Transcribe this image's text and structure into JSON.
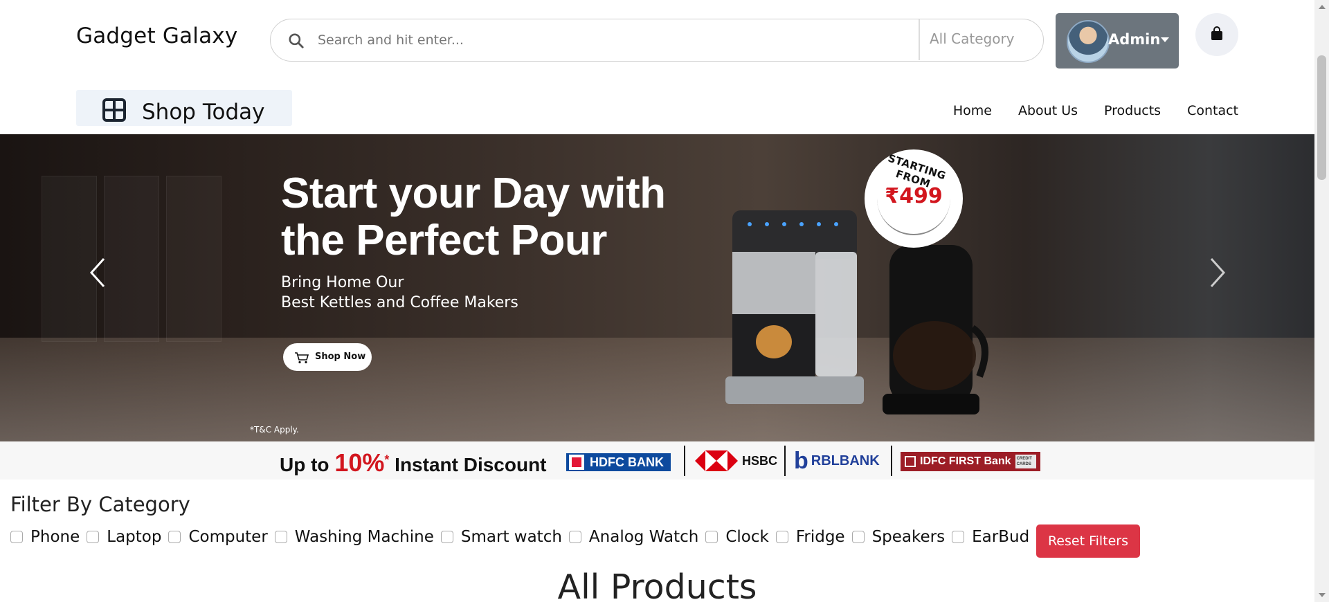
{
  "header": {
    "brand": "Gadget Galaxy",
    "search_placeholder": "Search and hit enter...",
    "category_select": "All Category",
    "user_label": "Admin",
    "cart_icon": "shopping-bag-icon"
  },
  "subheader": {
    "shop_today": "Shop Today",
    "nav": [
      "Home",
      "About Us",
      "Products",
      "Contact"
    ]
  },
  "banner": {
    "headline_line1": "Start your Day with",
    "headline_line2": "the Perfect Pour",
    "sub_line1": "Bring Home Our",
    "sub_line2": "Best Kettles and Coffee Makers",
    "cta": "Shop Now",
    "badge_top": "STARTING FROM",
    "badge_price": "₹499",
    "tnc": "*T&C Apply."
  },
  "offer": {
    "prefix": "Up to",
    "percent": "10%",
    "star": "*",
    "suffix": "Instant Discount",
    "banks": [
      "HDFC BANK",
      "HSBC",
      "RBLBANK",
      "IDFC FIRST Bank"
    ],
    "idfc_tag": "CREDIT CARDS"
  },
  "filters": {
    "title": "Filter By Category",
    "categories": [
      "Phone",
      "Laptop",
      "Computer",
      "Washing Machine",
      "Smart watch",
      "Analog Watch",
      "Clock",
      "Fridge",
      "Speakers",
      "EarBud"
    ],
    "reset": "Reset Filters"
  },
  "products": {
    "title": "All Products"
  },
  "colors": {
    "reset_button": "#dc3545",
    "admin_button": "#6c757d",
    "price_red": "#d2161e"
  }
}
